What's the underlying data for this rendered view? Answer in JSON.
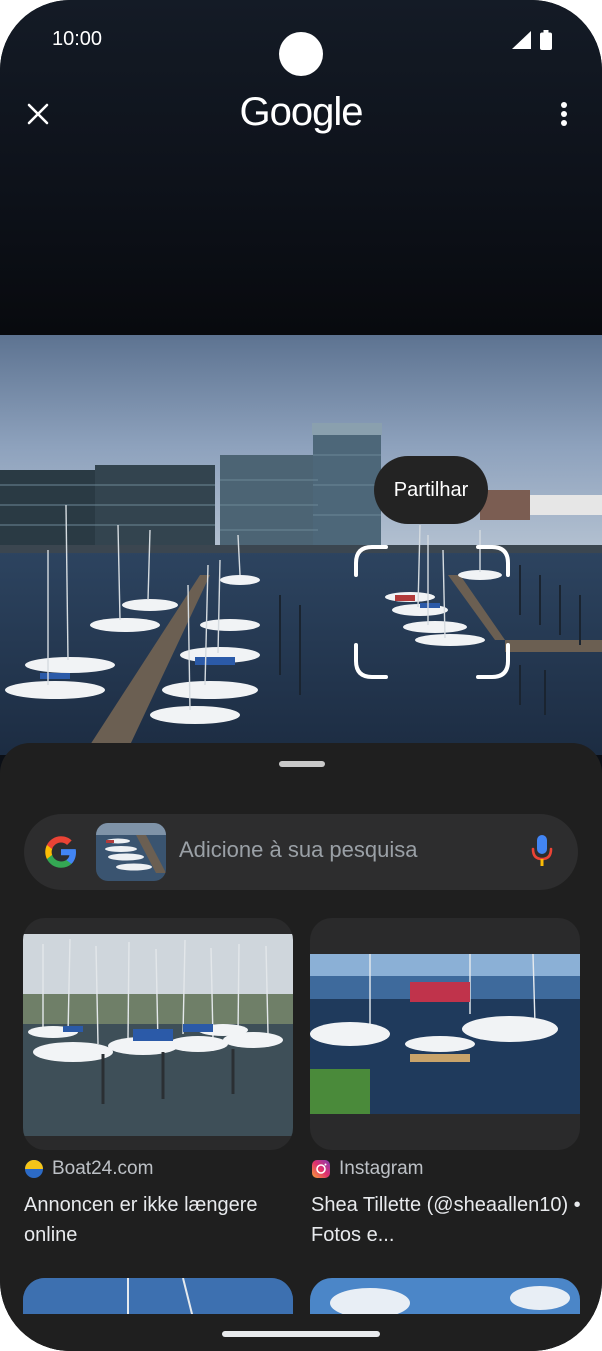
{
  "status_bar": {
    "time": "10:00"
  },
  "header": {
    "logo_text": "Google",
    "close_icon": "close-icon",
    "menu_icon": "more-vert-icon"
  },
  "photo": {
    "share_label": "Partilhar"
  },
  "search": {
    "placeholder": "Adicione à sua pesquisa",
    "mic_icon": "mic-icon"
  },
  "results": [
    {
      "source": "Boat24.com",
      "title": "Annoncen er ikke længere online"
    },
    {
      "source": "Instagram",
      "title": "Shea Tillette (@sheaallen10) • Fotos e..."
    }
  ],
  "colors": {
    "sheet": "#1f1f1f",
    "search_bar": "#2d2d2e",
    "accent_blue": "#4285f4"
  }
}
